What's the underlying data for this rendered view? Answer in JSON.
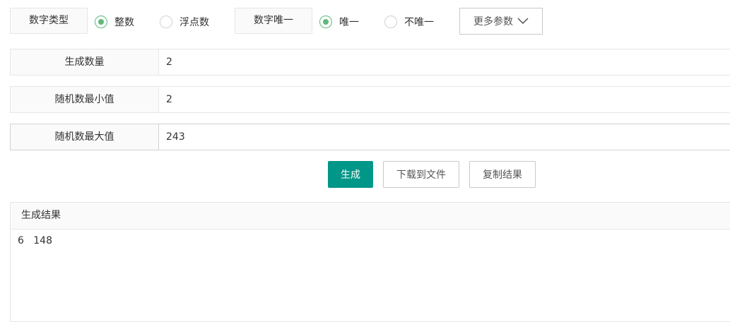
{
  "options": {
    "number_type_label": "数字类型",
    "number_type_options": [
      "整数",
      "浮点数"
    ],
    "number_type_selected": "整数",
    "unique_label": "数字唯一",
    "unique_options": [
      "唯一",
      "不唯一"
    ],
    "unique_selected": "唯一",
    "more_params_label": "更多参数"
  },
  "fields": {
    "count": {
      "label": "生成数量",
      "value": "2"
    },
    "min": {
      "label": "随机数最小值",
      "value": "2"
    },
    "max": {
      "label": "随机数最大值",
      "value": "243"
    }
  },
  "actions": {
    "generate_label": "生成",
    "download_label": "下载到文件",
    "copy_label": "复制结果"
  },
  "result": {
    "title": "生成结果",
    "content": "6   148"
  },
  "colors": {
    "primary": "#009688",
    "radio_checked": "#5fb878"
  },
  "icons": {
    "more_params": "chevron-down-icon"
  }
}
